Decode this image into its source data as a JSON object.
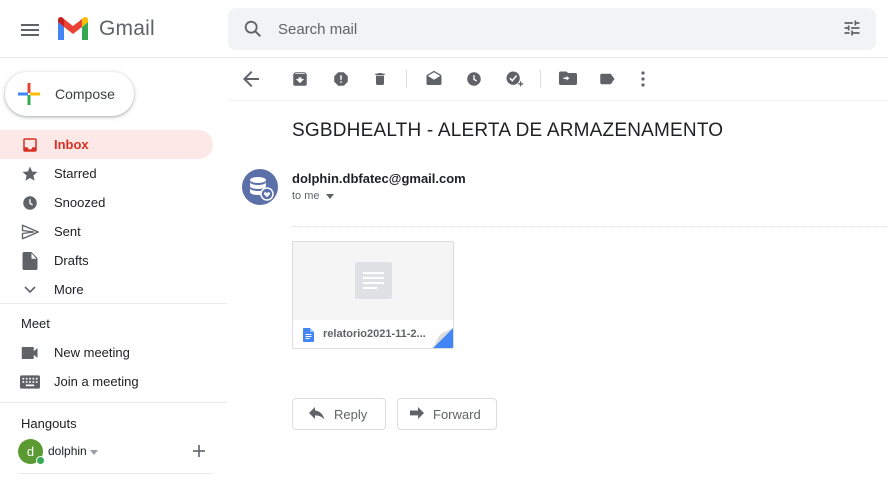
{
  "app": {
    "name": "Gmail"
  },
  "search": {
    "placeholder": "Search mail"
  },
  "compose": {
    "label": "Compose"
  },
  "nav": {
    "items": [
      {
        "label": "Inbox",
        "icon": "inbox-icon",
        "active": true
      },
      {
        "label": "Starred",
        "icon": "star-icon"
      },
      {
        "label": "Snoozed",
        "icon": "clock-icon"
      },
      {
        "label": "Sent",
        "icon": "send-icon"
      },
      {
        "label": "Drafts",
        "icon": "draft-icon"
      },
      {
        "label": "More",
        "icon": "chevron-down-icon"
      }
    ]
  },
  "meet": {
    "title": "Meet",
    "items": [
      {
        "label": "New meeting",
        "icon": "videocam-icon"
      },
      {
        "label": "Join a meeting",
        "icon": "keyboard-icon"
      }
    ]
  },
  "hangouts": {
    "title": "Hangouts",
    "user": {
      "initial": "d",
      "name": "dolphin",
      "status": "online"
    }
  },
  "toolbar": {
    "icons": [
      "back-arrow-icon",
      "archive-icon",
      "report-spam-icon",
      "delete-icon",
      "mark-unread-icon",
      "snooze-icon",
      "add-task-icon",
      "move-to-icon",
      "label-icon",
      "more-vert-icon"
    ]
  },
  "email": {
    "subject": "SGBDHEALTH - ALERTA DE ARMAZENAMENTO",
    "sender": "dolphin.dbfatec@gmail.com",
    "to": "to me",
    "attachment": {
      "name": "relatorio2021-11-2...",
      "type": "google-docs"
    },
    "actions": {
      "reply": "Reply",
      "forward": "Forward"
    }
  },
  "colors": {
    "accent_red": "#d93025",
    "active_bg": "#fce8e6",
    "search_bg": "#f1f3f4",
    "icon_gray": "#5f6368",
    "docs_blue": "#4285f4"
  }
}
